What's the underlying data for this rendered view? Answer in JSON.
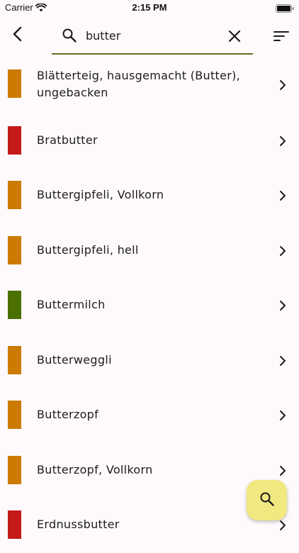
{
  "status_bar": {
    "carrier": "Carrier",
    "time": "2:15 PM"
  },
  "search": {
    "value": "butter",
    "placeholder": ""
  },
  "icons": {
    "back": "back-arrow-icon",
    "search": "search-icon",
    "clear": "close-icon",
    "sort": "sort-icon",
    "chevron": "chevron-right-icon",
    "fab": "search-icon"
  },
  "colors": {
    "orange": "#cc7a00",
    "red": "#c41a1a",
    "green": "#4b6f00",
    "accent": "#6b6a1f",
    "fab": "#f2e880"
  },
  "items": [
    {
      "label": "Blätterteig, hausgemacht (Butter), ungebacken",
      "color": "#cc7a00"
    },
    {
      "label": "Bratbutter",
      "color": "#c41a1a"
    },
    {
      "label": "Buttergipfeli, Vollkorn",
      "color": "#cc7a00"
    },
    {
      "label": "Buttergipfeli, hell",
      "color": "#cc7a00"
    },
    {
      "label": "Buttermilch",
      "color": "#4b6f00"
    },
    {
      "label": "Butterweggli",
      "color": "#cc7a00"
    },
    {
      "label": "Butterzopf",
      "color": "#cc7a00"
    },
    {
      "label": "Butterzopf, Vollkorn",
      "color": "#cc7a00"
    },
    {
      "label": "Erdnussbutter",
      "color": "#c41a1a"
    }
  ]
}
